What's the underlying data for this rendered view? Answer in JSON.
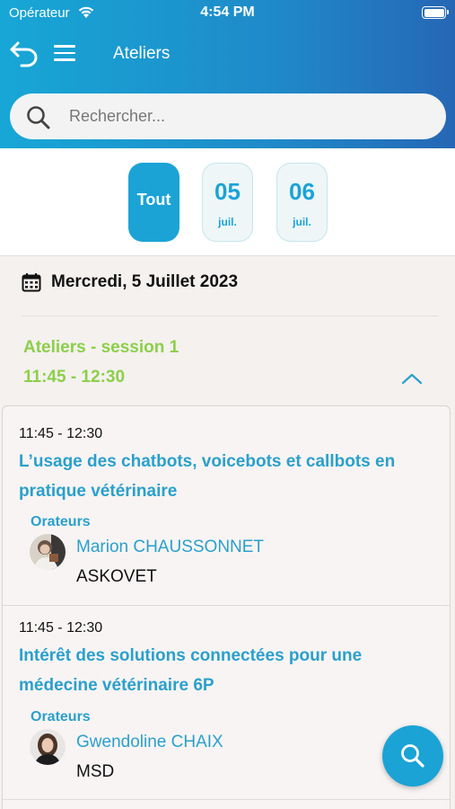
{
  "status_bar": {
    "carrier": "Opérateur",
    "time": "4:54 PM"
  },
  "header": {
    "title": "Ateliers",
    "back_icon": "undo-arrow-icon",
    "menu_icon": "hamburger-menu-icon"
  },
  "search": {
    "placeholder": "Rechercher..."
  },
  "date_filters": [
    {
      "label": "Tout",
      "active": true
    },
    {
      "day": "05",
      "month": "juil.",
      "active": false
    },
    {
      "day": "06",
      "month": "juil.",
      "active": false
    }
  ],
  "day": {
    "heading": "Mercredi, 5 Juillet 2023",
    "icon": "calendar-icon"
  },
  "session": {
    "title": "Ateliers - session 1",
    "time": "11:45 - 12:30",
    "expanded": true,
    "talks": [
      {
        "time": "11:45 - 12:30",
        "title": "L’usage des chatbots, voicebots et callbots en pratique vétérinaire",
        "speakers_label": "Orateurs",
        "speaker": {
          "name": "Marion CHAUSSONNET",
          "org": "ASKOVET"
        }
      },
      {
        "time": "11:45 - 12:30",
        "title": "Intérêt des solutions connectées pour une médecine vétérinaire 6P",
        "speakers_label": "Orateurs",
        "speaker": {
          "name": "Gwendoline CHAIX",
          "org": "MSD"
        }
      }
    ]
  },
  "colors": {
    "primary": "#1ba3d6",
    "session_green": "#8ccf4a",
    "link_blue": "#2aa0cc"
  },
  "fab": {
    "icon": "search-icon"
  }
}
